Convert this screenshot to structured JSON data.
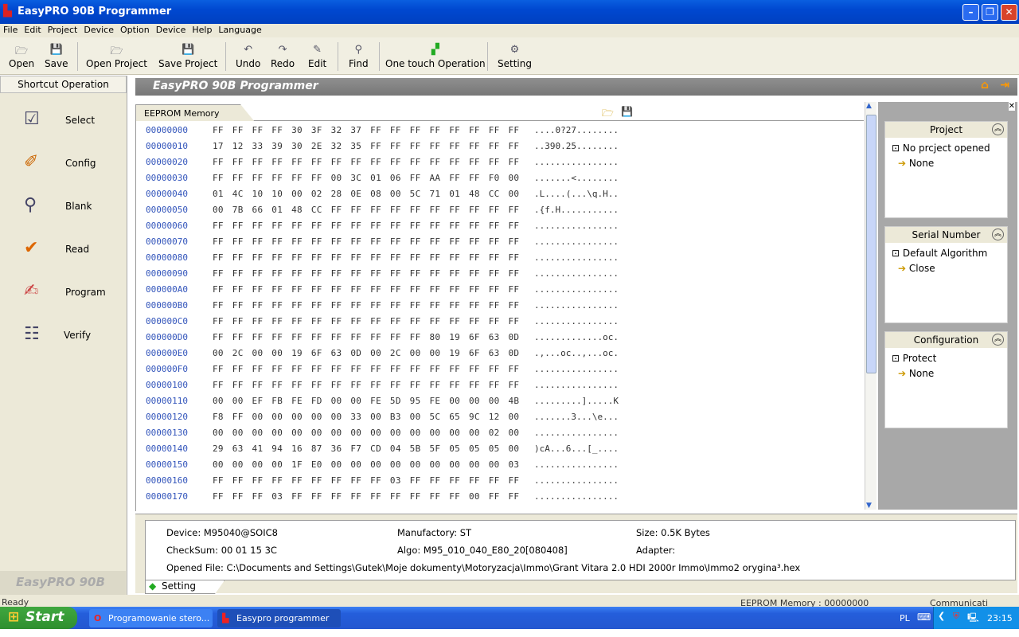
{
  "window": {
    "title": "EasyPRO 90B Programmer"
  },
  "menu": [
    "File",
    "Edit",
    "Project",
    "Device",
    "Option",
    "Device",
    "Help",
    "Language"
  ],
  "toolbar": [
    {
      "label": "Open",
      "icon": "folder-open-icon"
    },
    {
      "label": "Save",
      "icon": "save-icon"
    },
    {
      "label": "Open Project",
      "icon": "folder-open-icon"
    },
    {
      "label": "Save Project",
      "icon": "save-icon"
    },
    {
      "label": "Undo",
      "icon": "undo-icon"
    },
    {
      "label": "Redo",
      "icon": "redo-icon"
    },
    {
      "label": "Edit",
      "icon": "edit-icon"
    },
    {
      "label": "Find",
      "icon": "binoculars-icon"
    },
    {
      "label": "One touch Operation",
      "icon": "one-touch-icon"
    },
    {
      "label": "Setting",
      "icon": "setting-icon"
    }
  ],
  "shortcut": {
    "header": "Shortcut Operation",
    "items": [
      "Select",
      "Config",
      "Blank",
      "Read",
      "Program",
      "Verify"
    ],
    "brand": "EasyPRO 90B"
  },
  "main": {
    "header": "EasyPRO 90B Programmer",
    "tab": "EEPROM Memory"
  },
  "hex_rows": [
    [
      "00000000",
      "FF FF FF FF 30 3F 32 37 FF FF FF FF FF FF FF FF",
      "....0?27........"
    ],
    [
      "00000010",
      "17 12 33 39 30 2E 32 35 FF FF FF FF FF FF FF FF",
      "..390.25........"
    ],
    [
      "00000020",
      "FF FF FF FF FF FF FF FF FF FF FF FF FF FF FF FF",
      "................"
    ],
    [
      "00000030",
      "FF FF FF FF FF FF 00 3C 01 06 FF AA FF FF F0 00",
      ".......<........"
    ],
    [
      "00000040",
      "01 4C 10 10 00 02 28 0E 08 00 5C 71 01 48 CC 00",
      ".L....(...\\q.H.."
    ],
    [
      "00000050",
      "00 7B 66 01 48 CC FF FF FF FF FF FF FF FF FF FF",
      ".{f.H..........."
    ],
    [
      "00000060",
      "FF FF FF FF FF FF FF FF FF FF FF FF FF FF FF FF",
      "................"
    ],
    [
      "00000070",
      "FF FF FF FF FF FF FF FF FF FF FF FF FF FF FF FF",
      "................"
    ],
    [
      "00000080",
      "FF FF FF FF FF FF FF FF FF FF FF FF FF FF FF FF",
      "................"
    ],
    [
      "00000090",
      "FF FF FF FF FF FF FF FF FF FF FF FF FF FF FF FF",
      "................"
    ],
    [
      "000000A0",
      "FF FF FF FF FF FF FF FF FF FF FF FF FF FF FF FF",
      "................"
    ],
    [
      "000000B0",
      "FF FF FF FF FF FF FF FF FF FF FF FF FF FF FF FF",
      "................"
    ],
    [
      "000000C0",
      "FF FF FF FF FF FF FF FF FF FF FF FF FF FF FF FF",
      "................"
    ],
    [
      "000000D0",
      "FF FF FF FF FF FF FF FF FF FF FF 80 19 6F 63 0D",
      ".............oc."
    ],
    [
      "000000E0",
      "00 2C 00 00 19 6F 63 0D 00 2C 00 00 19 6F 63 0D",
      ".,...oc..,...oc."
    ],
    [
      "000000F0",
      "FF FF FF FF FF FF FF FF FF FF FF FF FF FF FF FF",
      "................"
    ],
    [
      "00000100",
      "FF FF FF FF FF FF FF FF FF FF FF FF FF FF FF FF",
      "................"
    ],
    [
      "00000110",
      "00 00 EF FB FE FD 00 00 FE 5D 95 FE 00 00 00 4B",
      ".........].....K"
    ],
    [
      "00000120",
      "F8 FF 00 00 00 00 00 33 00 B3 00 5C 65 9C 12 00",
      ".......3...\\e..."
    ],
    [
      "00000130",
      "00 00 00 00 00 00 00 00 00 00 00 00 00 00 02 00",
      "................"
    ],
    [
      "00000140",
      "29 63 41 94 16 87 36 F7 CD 04 5B 5F 05 05 05 00",
      ")cA...6...[_...."
    ],
    [
      "00000150",
      "00 00 00 00 1F E0 00 00 00 00 00 00 00 00 00 03",
      "................"
    ],
    [
      "00000160",
      "FF FF FF FF FF FF FF FF FF 03 FF FF FF FF FF FF",
      "................"
    ],
    [
      "00000170",
      "FF FF FF 03 FF FF FF FF FF FF FF FF FF 00 FF FF",
      "................"
    ]
  ],
  "panels": [
    {
      "title": "Project",
      "item": "No prcject opened",
      "sub": "None"
    },
    {
      "title": "Serial Number",
      "item": "Default Algorithm",
      "sub": "Close"
    },
    {
      "title": "Configuration",
      "item": "Protect",
      "sub": "None"
    }
  ],
  "info": {
    "device": "Device: M95040@SOIC8",
    "manufactory": "Manufactory: ST",
    "size": "Size: 0.5K Bytes",
    "checksum": "CheckSum: 00 01 15 3C",
    "algo": "Algo: M95_010_040_E80_20[080408]",
    "adapter": "Adapter:",
    "opened_file": "Opened File: C:\\Documents and Settings\\Gutek\\Moje dokumenty\\Motoryzacja\\Immo\\Grant Vitara 2.0 HDI 2000r Immo\\Immo2 orygina³.hex",
    "tab": "Setting"
  },
  "status": {
    "left": "Ready",
    "memory": "EEPROM Memory : 00000000",
    "comm": "Communicati"
  },
  "taskbar": {
    "start": "Start",
    "tasks": [
      "Programowanie stero...",
      "Easypro programmer"
    ],
    "lang": "PL",
    "time": "23:15"
  }
}
